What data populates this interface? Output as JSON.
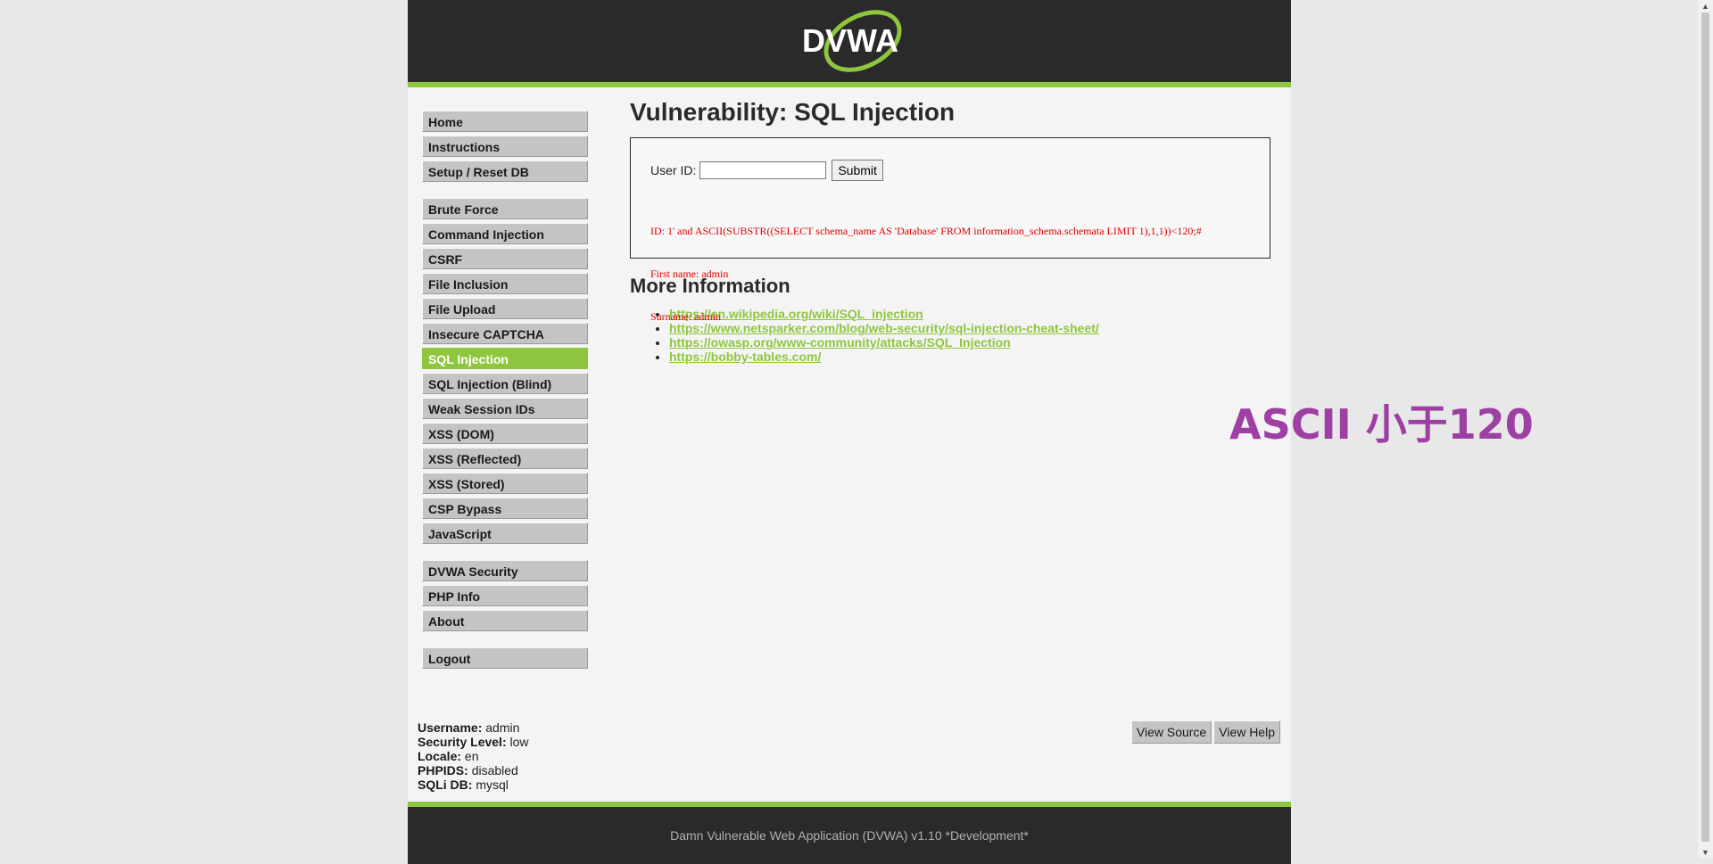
{
  "brand": {
    "logo_text": "DVWA",
    "accent": "#8fc63f",
    "dark": "#2a2a2a"
  },
  "menu": {
    "groups": [
      [
        "Home",
        "Instructions",
        "Setup / Reset DB"
      ],
      [
        "Brute Force",
        "Command Injection",
        "CSRF",
        "File Inclusion",
        "File Upload",
        "Insecure CAPTCHA",
        "SQL Injection",
        "SQL Injection (Blind)",
        "Weak Session IDs",
        "XSS (DOM)",
        "XSS (Reflected)",
        "XSS (Stored)",
        "CSP Bypass",
        "JavaScript"
      ],
      [
        "DVWA Security",
        "PHP Info",
        "About"
      ],
      [
        "Logout"
      ]
    ],
    "active": "SQL Injection"
  },
  "page": {
    "title": "Vulnerability: SQL Injection",
    "form": {
      "label": "User ID:",
      "value": "",
      "submit_label": "Submit"
    },
    "output": [
      "ID: 1' and ASCII(SUBSTR((SELECT schema_name AS 'Database' FROM information_schema.schemata LIMIT 1),1,1))<120;#",
      "First name: admin",
      "Surname: admin"
    ],
    "more_info_title": "More Information",
    "links": [
      "https://en.wikipedia.org/wiki/SQL_injection",
      "https://www.netsparker.com/blog/web-security/sql-injection-cheat-sheet/",
      "https://owasp.org/www-community/attacks/SQL_Injection",
      "https://bobby-tables.com/"
    ]
  },
  "footer_info": [
    {
      "key": "Username:",
      "value": "admin"
    },
    {
      "key": "Security Level:",
      "value": "low"
    },
    {
      "key": "Locale:",
      "value": "en"
    },
    {
      "key": "PHPIDS:",
      "value": "disabled"
    },
    {
      "key": "SQLi DB:",
      "value": "mysql"
    }
  ],
  "view_buttons": {
    "source": "View Source",
    "help": "View Help"
  },
  "footer": {
    "text": "Damn Vulnerable Web Application (DVWA) v1.10 *Development*"
  },
  "annotation": {
    "text": "ASCII 小于120",
    "color": "#9e3fa3"
  }
}
